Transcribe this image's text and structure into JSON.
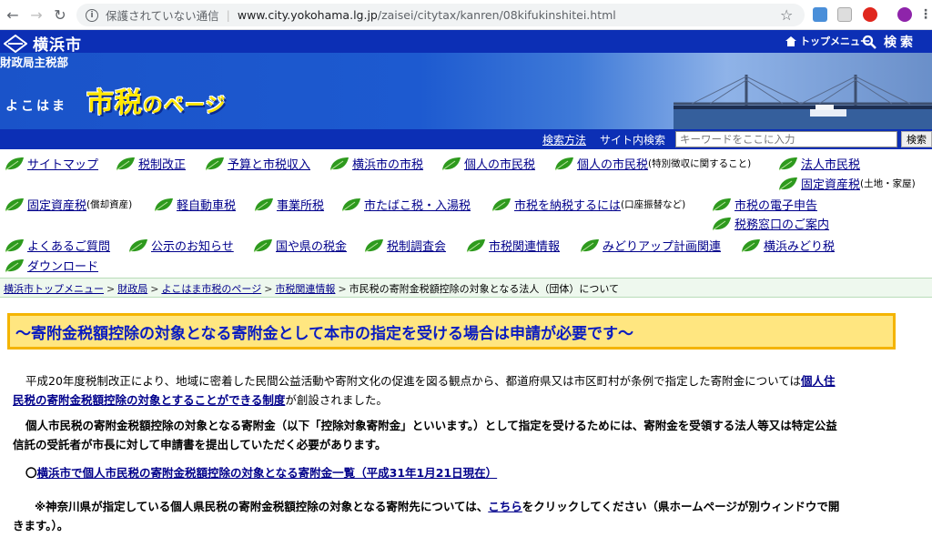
{
  "browser": {
    "security_label": "保護されていない通信",
    "host": "www.city.yokohama.lg.jp",
    "path": "/zaisei/citytax/kanren/08kifukinshitei.html"
  },
  "header": {
    "city_name": "横浜市",
    "top_menu": "トップメニュー",
    "search": "検索",
    "department": "財政局主税部",
    "yokohama_label": "よこはま",
    "title_main": "市税",
    "title_rest": "のページ"
  },
  "sitesearch": {
    "help": "検索方法",
    "label": "サイト内検索",
    "placeholder": "キーワードをここに入力",
    "button": "検索"
  },
  "nav": {
    "sitemap": "サイトマップ",
    "tax_reform": "税制改正",
    "budget": "予算と市税収入",
    "city_tax": "横浜市の市税",
    "individual_tax": "個人の市民税",
    "individual_tax_special": "個人の市民税",
    "individual_tax_special_note": "(特別徴収に関すること)",
    "corporate_tax": "法人市民税",
    "fixed_asset_land": "固定資産税",
    "fixed_asset_land_note": "(土地・家屋)",
    "fixed_asset_depreciable": "固定資産税",
    "fixed_asset_depreciable_note": "(償却資産)",
    "light_vehicle": "軽自動車税",
    "business_office": "事業所税",
    "tobacco_bath": "市たばこ税・入湯税",
    "payment": "市税を納税するには",
    "payment_note": "(口座振替など)",
    "e_filing": "市税の電子申告",
    "tax_counter": "税務窓口のご案内",
    "faq": "よくあるご質問",
    "notices": "公示のお知らせ",
    "national_tax": "国や県の税金",
    "tax_council": "税制調査会",
    "related_info": "市税関連情報",
    "green_up": "みどりアップ計画関連",
    "green_tax": "横浜みどり税",
    "download": "ダウンロード"
  },
  "breadcrumb": {
    "items": [
      "横浜市トップメニュー",
      "財政局",
      "よこはま市税のページ",
      "市税関連情報"
    ],
    "current": "市民税の寄附金税額控除の対象となる法人（団体）について"
  },
  "content": {
    "headline": "～寄附金税額控除の対象となる寄附金として本市の指定を受ける場合は申請が必要です～",
    "p1_text": "平成20年度税制改正により、地域に密着した民間公益活動や寄附文化の促進を図る観点から、都道府県又は市区町村が条例で指定した寄附金については",
    "p1_link_a": "個人住",
    "p1_link_b": "民税の寄附金税額控除の対象とすることができる制度",
    "p1_tail": "が創設されました。",
    "p2_line1": "個人市民税の寄附金税額控除の対象となる寄附金（以下「控除対象寄附金」といいます。）として指定を受けるためには、寄附金を受領する法人等又は特定公益",
    "p2_line2": "信託の受託者が市長に対して申請書を提出していただく必要があります。",
    "list_bullet": "〇",
    "list_link": "横浜市で個人市民税の寄附金税額控除の対象となる寄附金一覧（平成31年1月21日現在）",
    "note_a": "※神奈川県が指定している個人県民税の寄附金税額控除の対象となる寄附先については、",
    "note_link": "こちら",
    "note_b": "をクリックしてください（県ホームページが別ウィンドウで開",
    "note_line2": "きます。）。"
  },
  "colors": {
    "header_blue": "#0c2fb5",
    "link": "#00008b",
    "headline_text": "#0a1cc0",
    "headline_bg": "#ffe680",
    "headline_border": "#f4b400"
  }
}
